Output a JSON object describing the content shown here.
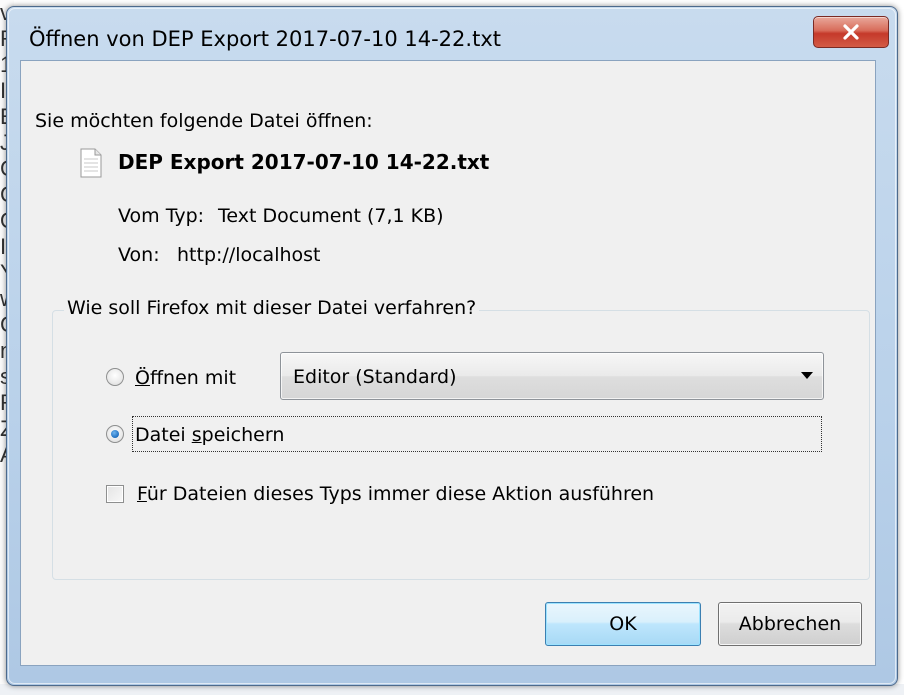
{
  "background": {
    "left_text_fragments": [
      "v",
      "R",
      "1",
      "I",
      "E",
      "J",
      "C",
      "C",
      "O",
      "I",
      "Y",
      "w",
      "C",
      "n",
      "s",
      "R",
      "Z",
      "A"
    ]
  },
  "dialog": {
    "title": "Öffnen von DEP Export 2017-07-10 14-22.txt",
    "prompt": "Sie möchten folgende Datei öffnen:",
    "file": {
      "name": "DEP Export 2017-07-10 14-22.txt",
      "type_label": "Vom Typ:",
      "type_value": "Text Document (7,1 KB)",
      "from_label": "Von:",
      "from_value": "http://localhost"
    },
    "action_group": {
      "legend": "Wie soll Firefox mit dieser Datei verfahren?",
      "open_with": {
        "accesskey": "Ö",
        "label_rest": "ffnen mit",
        "selected": false,
        "app_value": "Editor (Standard)"
      },
      "save_file": {
        "prefix": "Datei ",
        "accesskey": "s",
        "label_rest": "peichern",
        "selected": true
      },
      "always_do": {
        "accesskey": "F",
        "label_rest": "ür Dateien dieses Typs immer diese Aktion ausführen",
        "checked": false
      }
    },
    "buttons": {
      "ok": "OK",
      "cancel": "Abbrechen"
    }
  },
  "icons": {
    "close": "close-icon",
    "file": "text-file-icon",
    "dropdown": "dropdown-arrow-icon"
  },
  "colors": {
    "titlebar": "#b9d1ea",
    "close_button": "#c5392a",
    "dialog_bg": "#f0f0f0",
    "default_button": "#a7d9f5"
  }
}
